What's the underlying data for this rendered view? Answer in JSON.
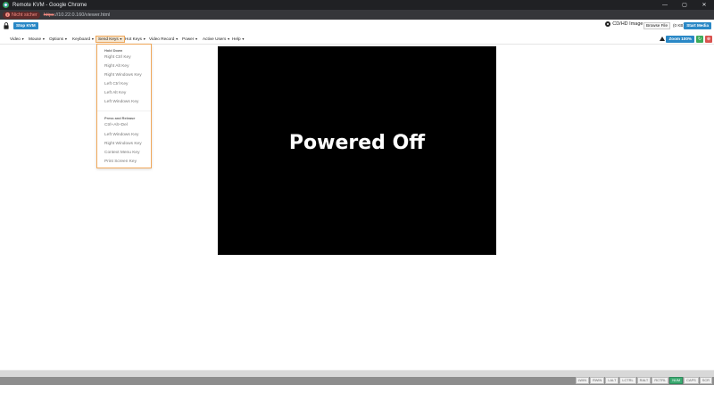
{
  "window": {
    "title": "Remote KVM - Google Chrome",
    "minimize": "—",
    "maximize": "▢",
    "close": "✕"
  },
  "address": {
    "security": "Nicht sicher",
    "scheme": "https",
    "rest": "://10.22.0.160/viewer.html"
  },
  "top": {
    "stop_kvm": "Stop KVM",
    "cd_label": "CD/HD Image:",
    "browse": "Browse File",
    "size": "(0 KB)",
    "start_media": "Start Media"
  },
  "menu": {
    "items": [
      "Video",
      "Mouse",
      "Options",
      "Keyboard",
      "Send Keys",
      "Hot Keys",
      "Video Record",
      "Power",
      "Active Users",
      "Help"
    ],
    "zoom": "Zoom 100%",
    "refresh_icon": "↻",
    "close_icon": "⊗"
  },
  "sendkeys": {
    "hold_down_header": "Hold Down",
    "hold_down": [
      "Right Ctrl Key",
      "Right Alt Key",
      "Right Windows Key",
      "Left Ctrl Key",
      "Left Alt Key",
      "Left Windows Key"
    ],
    "press_release_header": "Press and Release",
    "press_release": [
      "Ctrl+Alt+Del",
      "Left Windows Key",
      "Right Windows Key",
      "Context Menu Key",
      "Print Screen Key"
    ]
  },
  "screen": {
    "message": "Powered Off"
  },
  "status_keys": [
    {
      "label": "LWIN",
      "on": false
    },
    {
      "label": "RWIN",
      "on": false
    },
    {
      "label": "LALT",
      "on": false
    },
    {
      "label": "LCTRL",
      "on": false
    },
    {
      "label": "RALT",
      "on": false
    },
    {
      "label": "RCTRL",
      "on": false
    },
    {
      "label": "NUM",
      "on": true
    },
    {
      "label": "CAPS",
      "on": false
    },
    {
      "label": "SCR",
      "on": false
    }
  ]
}
